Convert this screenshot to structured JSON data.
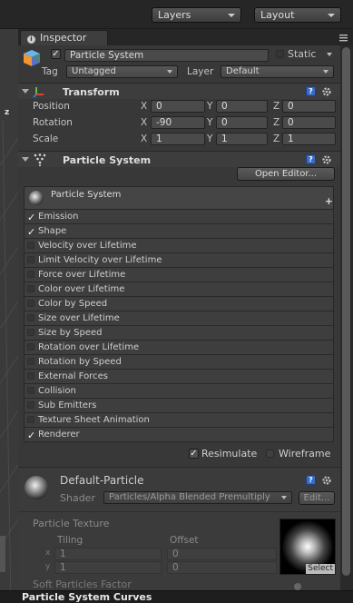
{
  "topbar": {
    "layers_label": "Layers",
    "layout_label": "Layout"
  },
  "tab": {
    "title": "Inspector"
  },
  "gameobject": {
    "name": "Particle System",
    "static_label": "Static",
    "tag_label": "Tag",
    "tag_value": "Untagged",
    "layer_label": "Layer",
    "layer_value": "Default"
  },
  "transform": {
    "title": "Transform",
    "rows": [
      {
        "label": "Position",
        "x": "0",
        "y": "0",
        "z": "0"
      },
      {
        "label": "Rotation",
        "x": "-90",
        "y": "0",
        "z": "0"
      },
      {
        "label": "Scale",
        "x": "1",
        "y": "1",
        "z": "1"
      }
    ],
    "axis_x": "X",
    "axis_y": "Y",
    "axis_z": "Z"
  },
  "particle": {
    "title": "Particle System",
    "open_editor": "Open Editor...",
    "system_name": "Particle System",
    "plus": "+",
    "modules": [
      {
        "label": "Emission",
        "checked": true
      },
      {
        "label": "Shape",
        "checked": true
      },
      {
        "label": "Velocity over Lifetime",
        "checked": false
      },
      {
        "label": "Limit Velocity over Lifetime",
        "checked": false
      },
      {
        "label": "Force over Lifetime",
        "checked": false
      },
      {
        "label": "Color over Lifetime",
        "checked": false
      },
      {
        "label": "Color by Speed",
        "checked": false
      },
      {
        "label": "Size over Lifetime",
        "checked": false
      },
      {
        "label": "Size by Speed",
        "checked": false
      },
      {
        "label": "Rotation over Lifetime",
        "checked": false
      },
      {
        "label": "Rotation by Speed",
        "checked": false
      },
      {
        "label": "External Forces",
        "checked": false
      },
      {
        "label": "Collision",
        "checked": false
      },
      {
        "label": "Sub Emitters",
        "checked": false
      },
      {
        "label": "Texture Sheet Animation",
        "checked": false
      },
      {
        "label": "Renderer",
        "checked": true
      }
    ],
    "resimulate_label": "Resimulate",
    "wireframe_label": "Wireframe"
  },
  "material": {
    "name": "Default-Particle",
    "shader_label": "Shader",
    "shader_value": "Particles/Alpha Blended Premultiply",
    "edit_label": "Edit...",
    "texture_label": "Particle Texture",
    "tiling_label": "Tiling",
    "offset_label": "Offset",
    "x_label": "x",
    "y_label": "y",
    "tiling_x": "1",
    "tiling_y": "1",
    "offset_x": "0",
    "offset_y": "0",
    "select_label": "Select",
    "soft_label": "Soft Particles Factor"
  },
  "bottom": {
    "title": "Particle System Curves"
  },
  "icons": [
    "info-icon",
    "tab-menu-icon",
    "cube-icon",
    "transform-axes-icon",
    "help-icon",
    "gear-icon",
    "particle-icon",
    "check-icon"
  ]
}
